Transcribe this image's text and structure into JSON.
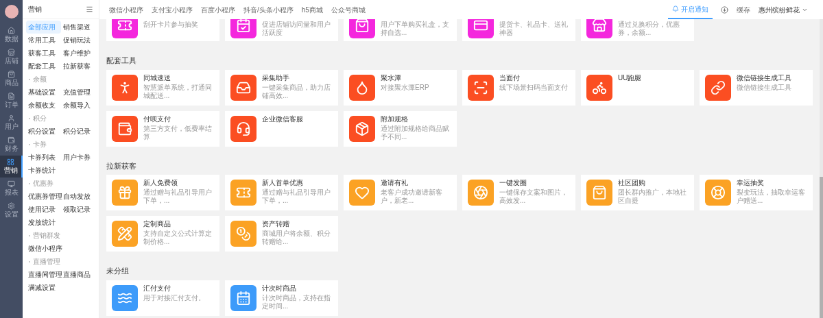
{
  "rail": {
    "items": [
      {
        "kind": "home",
        "label": "数据",
        "selected": false
      },
      {
        "kind": "store",
        "label": "店铺",
        "selected": false
      },
      {
        "kind": "bag",
        "label": "商品",
        "selected": false
      },
      {
        "kind": "doc",
        "label": "订单",
        "selected": false
      },
      {
        "kind": "user",
        "label": "用户",
        "selected": false
      },
      {
        "kind": "wallet",
        "label": "财务",
        "selected": false
      },
      {
        "kind": "grid",
        "label": "营销",
        "selected": true
      },
      {
        "kind": "monitor",
        "label": "报表",
        "selected": false
      },
      {
        "kind": "gear",
        "label": "设置",
        "selected": false
      }
    ]
  },
  "menu": {
    "title": "营销",
    "groups": [
      {
        "items": [
          {
            "label": "全部应用",
            "selected": true
          },
          {
            "label": "销售渠道",
            "selected": false
          },
          {
            "label": "常用工具",
            "selected": false
          },
          {
            "label": "促销玩法",
            "selected": false
          },
          {
            "label": "获客工具",
            "selected": false
          },
          {
            "label": "客户维护",
            "selected": false
          },
          {
            "label": "配套工具",
            "selected": false
          },
          {
            "label": "拉新获客",
            "selected": false
          }
        ]
      },
      {
        "heading": "余额",
        "items": [
          {
            "label": "基础设置",
            "selected": false
          },
          {
            "label": "充值管理",
            "selected": false
          },
          {
            "label": "余额收支",
            "selected": false
          },
          {
            "label": "余额导入",
            "selected": false
          }
        ]
      },
      {
        "heading": "积分",
        "items": [
          {
            "label": "积分设置",
            "selected": false
          },
          {
            "label": "积分记录",
            "selected": false
          }
        ]
      },
      {
        "heading": "卡券",
        "items": [
          {
            "label": "卡券列表",
            "selected": false
          },
          {
            "label": "用户卡券",
            "selected": false
          },
          {
            "label": "卡券统计",
            "selected": false
          }
        ]
      },
      {
        "heading": "优惠券",
        "items": [
          {
            "label": "优惠券管理",
            "selected": false
          },
          {
            "label": "自动发放",
            "selected": false
          },
          {
            "label": "使用记录",
            "selected": false
          },
          {
            "label": "领取记录",
            "selected": false
          },
          {
            "label": "发放统计",
            "selected": false
          }
        ]
      },
      {
        "heading": "营销群发",
        "items": [
          {
            "label": "微信小程序",
            "selected": false
          }
        ]
      },
      {
        "heading": "直播管理",
        "items": [
          {
            "label": "直播间管理",
            "selected": false
          },
          {
            "label": "直播商品",
            "selected": false
          }
        ]
      },
      {
        "items": [
          {
            "label": "满减设置",
            "selected": false
          }
        ]
      }
    ]
  },
  "top_bar": {
    "tabs": [
      {
        "label": "微信小程序"
      },
      {
        "label": "支付宝小程序"
      },
      {
        "label": "百度小程序"
      },
      {
        "label": "抖音/头条小程序"
      },
      {
        "label": "h5商城"
      },
      {
        "label": "公众号商城"
      }
    ],
    "notify": {
      "label": "开启通知",
      "selected": true
    },
    "cache": "缓存",
    "store": "惠州缤纷鲜花"
  },
  "cut_off_row": [
    {
      "kind": "ticket",
      "desc": "刮开卡片参与抽奖",
      "color": "#f427dd"
    },
    {
      "kind": "calendar-check",
      "desc": "促进店铺访问量和用户活跃度",
      "color": "#f427dd"
    },
    {
      "kind": "bag",
      "desc": "用户下单购买礼盒，支持自选...",
      "color": "#f427dd"
    },
    {
      "kind": "card",
      "desc": "提货卡、礼品卡、送礼神器",
      "color": "#f427dd"
    },
    {
      "kind": "store",
      "desc": "通过兑换积分，优惠券，余额...",
      "color": "#f427dd"
    }
  ],
  "sections": [
    {
      "title": "配套工具",
      "tools": [
        {
          "kind": "runner",
          "name": "同城速送",
          "desc": "智慧派单系统，打通同城配送...",
          "color": "#fb4e22"
        },
        {
          "kind": "inbox",
          "name": "采集助手",
          "desc": "一键采集商品，助力店铺高效...",
          "color": "#fb4e22"
        },
        {
          "kind": "drop",
          "name": "聚水潭",
          "desc": "对接聚水潭ERP",
          "color": "#fb4e22"
        },
        {
          "kind": "scan",
          "name": "当面付",
          "desc": "线下场景扫码当面支付",
          "color": "#fb4e22"
        },
        {
          "kind": "bike",
          "name": "UU跑腿",
          "color": "#fb4e22"
        },
        {
          "kind": "link",
          "name": "微信链接生成工具",
          "desc": "微信链接生成工具",
          "color": "#fb4e22"
        },
        {
          "kind": "wallet",
          "name": "付呗支付",
          "desc": "第三方支付，低费率结算",
          "color": "#fb4e22"
        },
        {
          "kind": "headset",
          "name": "企业微信客服",
          "color": "#fb4e22"
        },
        {
          "kind": "box",
          "name": "附加规格",
          "desc": "通过附加规格给商品赋予不同...",
          "color": "#fb4e22"
        }
      ]
    },
    {
      "title": "拉新获客",
      "tools": [
        {
          "kind": "gift",
          "name": "新人免费领",
          "desc": "通过赠与礼品引导用户下单，...",
          "color": "#fba224"
        },
        {
          "kind": "ticket",
          "name": "新人首单优惠",
          "desc": "通过赠与礼品引导用户下单，...",
          "color": "#fba224"
        },
        {
          "kind": "heart",
          "name": "邀请有礼",
          "desc": "老客户成功邀请新客户，新老...",
          "color": "#fba224"
        },
        {
          "kind": "aperture",
          "name": "一键发圈",
          "desc": "一键保存文案和图片，高效发...",
          "color": "#fba224"
        },
        {
          "kind": "bag",
          "name": "社区团购",
          "desc": "团长群内推广，本地社区自提",
          "color": "#fba224"
        },
        {
          "kind": "wheel",
          "name": "幸运抽奖",
          "desc": "裂变玩法，抽取幸运客户赠送...",
          "color": "#fba224"
        },
        {
          "kind": "pencil",
          "name": "定制商品",
          "desc": "支持自定义公式计算定制价格...",
          "color": "#fba224"
        },
        {
          "kind": "coins",
          "name": "资产转赠",
          "desc": "商城用户将余额、积分转赠给...",
          "color": "#fba224"
        }
      ]
    },
    {
      "title": "未分组",
      "tools": [
        {
          "kind": "waves",
          "name": "汇付支付",
          "desc": "用于对接汇付支付。",
          "color": "#3d9bfa"
        },
        {
          "kind": "calendar",
          "name": "计次时商品",
          "desc": "计次时商品，支持在指定时间...",
          "color": "#3d9bfa"
        }
      ]
    }
  ]
}
